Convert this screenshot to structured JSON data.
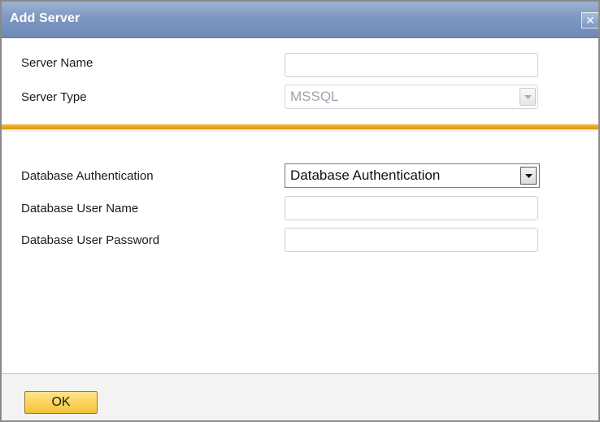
{
  "dialog": {
    "title": "Add Server",
    "close_label": "✕"
  },
  "server_section": {
    "server_name": {
      "label": "Server Name",
      "value": "",
      "placeholder": ""
    },
    "server_type": {
      "label": "Server Type",
      "value": "MSSQL",
      "disabled": true
    }
  },
  "auth_section": {
    "authentication": {
      "label": "Database Authentication",
      "value": "Database Authentication"
    },
    "user_name": {
      "label": "Database User Name",
      "value": "",
      "placeholder": ""
    },
    "user_password": {
      "label": "Database User Password",
      "value": "",
      "placeholder": ""
    }
  },
  "footer": {
    "ok_label": "OK"
  },
  "colors": {
    "titlebar": "#7d98c0",
    "divider": "#e8a51a",
    "ok_button": "#fbd35a"
  },
  "icons": {
    "dropdown": "chevron-down-icon",
    "close": "close-icon"
  }
}
